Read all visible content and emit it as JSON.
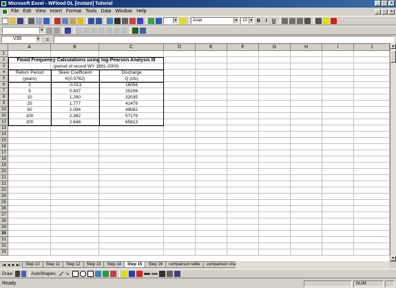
{
  "window": {
    "title": "Microsoft Excel - WFlood DL [Instant] Tutorial"
  },
  "menu": [
    "File",
    "Edit",
    "View",
    "Insert",
    "Format",
    "Tools",
    "Data",
    "Window",
    "Help"
  ],
  "toolbar": {
    "font": "Arial",
    "size": "10",
    "bold": "B",
    "italic": "I",
    "underline": "U"
  },
  "formula_bar": {
    "name_box": "V30",
    "equals": "=",
    "value": ""
  },
  "columns": [
    "A",
    "B",
    "C",
    "D",
    "E",
    "F",
    "G",
    "H",
    "I",
    "J"
  ],
  "rows": [
    "1",
    "2",
    "3",
    "4",
    "5",
    "6",
    "7",
    "8",
    "9",
    "10",
    "11",
    "12",
    "13",
    "14",
    "15",
    "16",
    "17",
    "18",
    "19",
    "20",
    "21",
    "22",
    "23",
    "24",
    "25",
    "26",
    "27",
    "28",
    "29",
    "30",
    "31",
    "32",
    "33"
  ],
  "sheet": {
    "title": "Flood Frequency Calculations using log-Pearson Analysis III",
    "subtitle": "(period of record WY 1991-2000)",
    "headers": [
      "Return Period",
      "Skew Coefficient",
      "Discharge"
    ],
    "units": [
      "(years)",
      "K(0.0762)",
      "Q (cfs)"
    ],
    "data": [
      [
        "2",
        "-0.013",
        "16058"
      ],
      [
        "5",
        "0.837",
        "25206"
      ],
      [
        "10",
        "1.290",
        "32035"
      ],
      [
        "25",
        "1.777",
        "41479"
      ],
      [
        "50",
        "2.094",
        "49082"
      ],
      [
        "100",
        "2.382",
        "57179"
      ],
      [
        "200",
        "2.648",
        "65813"
      ]
    ]
  },
  "tabs": [
    "Step 10",
    "Step 11",
    "Step 12",
    "Step 13",
    "Step 14",
    "Step 15",
    "Step 16",
    "comparison table",
    "comparison chart"
  ],
  "active_tab": "Step 15",
  "drawbar": {
    "draw": "Draw",
    "autoshapes": "AutoShapes"
  },
  "status": {
    "text": "Ready",
    "num": "NUM"
  }
}
